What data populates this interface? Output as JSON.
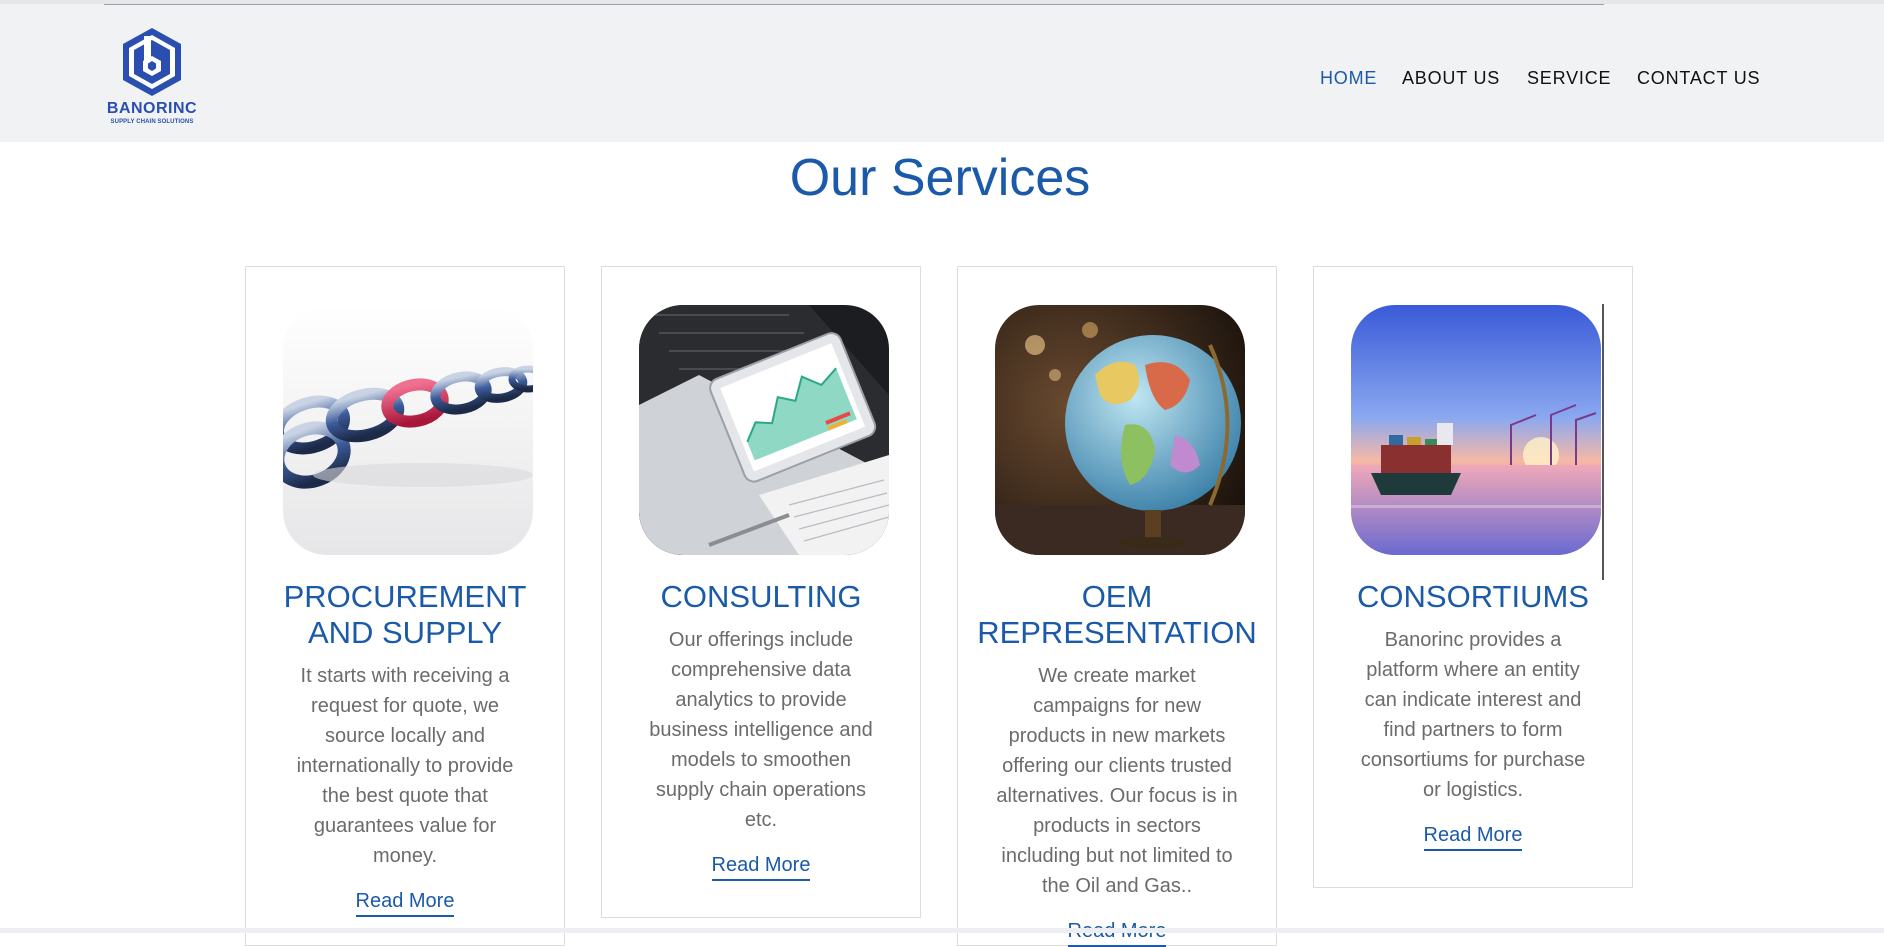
{
  "brand": {
    "name": "BANORINC",
    "tagline": "SUPPLY CHAIN SOLUTIONS",
    "color": "#2a4fb0"
  },
  "nav": {
    "items": [
      {
        "label": "HOME",
        "active": true
      },
      {
        "label": "ABOUT US",
        "active": false
      },
      {
        "label": "SERVICE",
        "active": false
      },
      {
        "label": "CONTACT US",
        "active": false
      }
    ]
  },
  "page": {
    "title": "Our Services",
    "accent_color": "#1a5aa8"
  },
  "services": [
    {
      "title_line1": "PROCUREMENT",
      "title_line2": "AND SUPPLY",
      "image": "chain-links-image",
      "text": [
        "It starts with receiving a",
        "request for quote, we",
        "source locally and",
        "internationally to provide",
        "the best quote that",
        "guarantees value for",
        "money."
      ],
      "link": "Read More"
    },
    {
      "title_line1": "CONSULTING",
      "title_line2": "",
      "image": "laptop-tablet-analytics-image",
      "text": [
        "Our offerings include",
        "comprehensive data",
        "analytics to provide",
        "business intelligence and",
        "models to smoothen",
        "supply chain operations",
        "etc."
      ],
      "link": "Read More"
    },
    {
      "title_line1": "OEM",
      "title_line2": "REPRESENTATION",
      "image": "globe-image",
      "text": [
        "We create market",
        "campaigns for new",
        "products in new markets",
        "offering our clients trusted",
        "alternatives. Our focus is in",
        "products in sectors",
        "including but not limited to",
        "the Oil and Gas.."
      ],
      "link": "Read More"
    },
    {
      "title_line1": "CONSORTIUMS",
      "title_line2": "",
      "image": "cargo-ship-port-image",
      "text": [
        "Banorinc provides a",
        "platform where an entity",
        "can indicate interest and",
        "find partners to form",
        "consortiums for purchase",
        "or logistics."
      ],
      "link": "Read More"
    }
  ]
}
